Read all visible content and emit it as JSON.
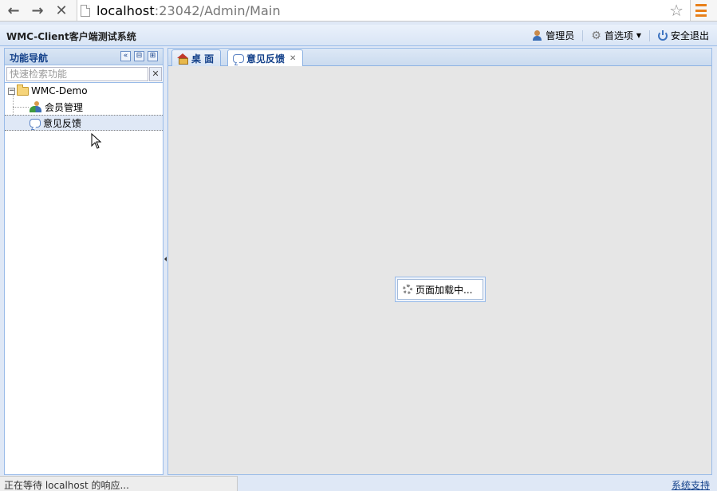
{
  "browser": {
    "url_host": "localhost",
    "url_rest": ":23042/Admin/Main",
    "back_glyph": "←",
    "forward_glyph": "→",
    "stop_glyph": "✕",
    "star_glyph": "☆"
  },
  "header": {
    "app_title": "WMC-Client客户端测试系统",
    "user_label": "管理员",
    "preferences_label": "首选项",
    "logout_label": "安全退出"
  },
  "nav_panel": {
    "title": "功能导航",
    "search_placeholder": "快速检索功能",
    "clear_glyph": "✕",
    "tools": [
      "«",
      "⊟",
      "⊞"
    ],
    "tree": {
      "root": "WMC-Demo",
      "expander": "−",
      "children": [
        {
          "label": "会员管理",
          "icon": "members-icon"
        },
        {
          "label": "意见反馈",
          "icon": "feedback-icon",
          "selected": true
        }
      ]
    }
  },
  "tabs": [
    {
      "label": "桌 面",
      "icon": "home-icon",
      "active": false
    },
    {
      "label": "意见反馈",
      "icon": "feedback-icon",
      "active": true,
      "close_glyph": "✕"
    }
  ],
  "loading": {
    "text": "页面加载中..."
  },
  "status": {
    "message": "正在等待 localhost 的响应...",
    "support_link": "系统支持"
  },
  "colors": {
    "accent": "#15428b",
    "border": "#99bbe8",
    "menu_orange": "#e8801a"
  }
}
